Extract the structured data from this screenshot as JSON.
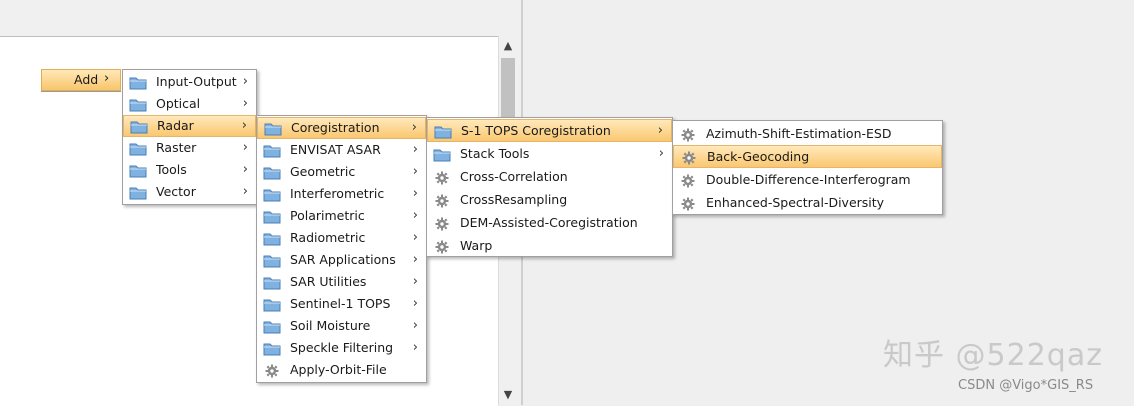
{
  "add_button": {
    "label": "Add",
    "chevron": "›"
  },
  "menus": {
    "level1": [
      {
        "label": "Input-Output",
        "icon": "folder-icon",
        "submenu": true
      },
      {
        "label": "Optical",
        "icon": "folder-icon",
        "submenu": true
      },
      {
        "label": "Radar",
        "icon": "folder-icon",
        "submenu": true,
        "highlighted": true
      },
      {
        "label": "Raster",
        "icon": "folder-icon",
        "submenu": true
      },
      {
        "label": "Tools",
        "icon": "folder-icon",
        "submenu": true
      },
      {
        "label": "Vector",
        "icon": "folder-icon",
        "submenu": true
      }
    ],
    "level2": [
      {
        "label": "Coregistration",
        "icon": "folder-icon",
        "submenu": true,
        "highlighted": true
      },
      {
        "label": "ENVISAT ASAR",
        "icon": "folder-icon",
        "submenu": true
      },
      {
        "label": "Geometric",
        "icon": "folder-icon",
        "submenu": true
      },
      {
        "label": "Interferometric",
        "icon": "folder-icon",
        "submenu": true
      },
      {
        "label": "Polarimetric",
        "icon": "folder-icon",
        "submenu": true
      },
      {
        "label": "Radiometric",
        "icon": "folder-icon",
        "submenu": true
      },
      {
        "label": "SAR Applications",
        "icon": "folder-icon",
        "submenu": true
      },
      {
        "label": "SAR Utilities",
        "icon": "folder-icon",
        "submenu": true
      },
      {
        "label": "Sentinel-1 TOPS",
        "icon": "folder-icon",
        "submenu": true
      },
      {
        "label": "Soil Moisture",
        "icon": "folder-icon",
        "submenu": true
      },
      {
        "label": "Speckle Filtering",
        "icon": "folder-icon",
        "submenu": true
      },
      {
        "label": "Apply-Orbit-File",
        "icon": "gear-icon",
        "submenu": false
      }
    ],
    "level3": [
      {
        "label": "S-1 TOPS Coregistration",
        "icon": "folder-icon",
        "submenu": true,
        "highlighted": true
      },
      {
        "label": "Stack Tools",
        "icon": "folder-icon",
        "submenu": true
      },
      {
        "label": "Cross-Correlation",
        "icon": "gear-icon",
        "submenu": false
      },
      {
        "label": "CrossResampling",
        "icon": "gear-icon",
        "submenu": false
      },
      {
        "label": "DEM-Assisted-Coregistration",
        "icon": "gear-icon",
        "submenu": false
      },
      {
        "label": "Warp",
        "icon": "gear-icon",
        "submenu": false
      }
    ],
    "level4": [
      {
        "label": "Azimuth-Shift-Estimation-ESD",
        "icon": "gear-icon",
        "submenu": false
      },
      {
        "label": "Back-Geocoding",
        "icon": "gear-icon",
        "submenu": false,
        "highlighted": true
      },
      {
        "label": "Double-Difference-Interferogram",
        "icon": "gear-icon",
        "submenu": false
      },
      {
        "label": "Enhanced-Spectral-Diversity",
        "icon": "gear-icon",
        "submenu": false
      }
    ]
  },
  "submenu_chevron": "›",
  "scrollbar": {
    "up": "▲",
    "down": "▼"
  },
  "watermark": {
    "line1": "知乎 @522qaz",
    "line2": "CSDN @Vigo*GIS_RS"
  },
  "colors": {
    "highlight": "#fac770",
    "folder": "#7fb2e0",
    "gear": "#8a8a8a"
  }
}
